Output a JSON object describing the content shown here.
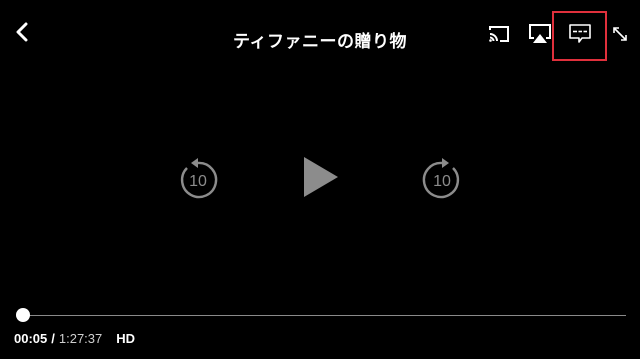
{
  "header": {
    "title": "ティファニーの贈り物",
    "back_icon": "chevron-left-icon",
    "actions": [
      {
        "name": "cast",
        "icon": "cast-icon"
      },
      {
        "name": "airplay",
        "icon": "airplay-icon"
      },
      {
        "name": "subtitles",
        "icon": "subtitles-icon",
        "highlighted": true
      },
      {
        "name": "fullscreen",
        "icon": "expand-icon"
      }
    ],
    "highlight_color": "#e0303c"
  },
  "controls": {
    "rewind_label": "10",
    "forward_label": "10",
    "play_icon": "play-icon"
  },
  "playback": {
    "current_time": "00:05",
    "separator": "/",
    "total_time": "1:27:37",
    "quality": "HD",
    "progress_fraction": 0.001
  },
  "colors": {
    "background": "#000000",
    "control_gray": "#8c8c8c",
    "text": "#ffffff"
  }
}
